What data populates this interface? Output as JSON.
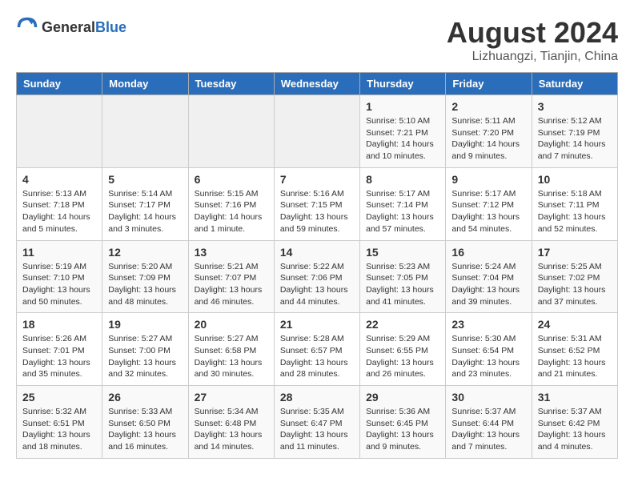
{
  "header": {
    "logo_general": "General",
    "logo_blue": "Blue",
    "month_year": "August 2024",
    "location": "Lizhuangzi, Tianjin, China"
  },
  "weekdays": [
    "Sunday",
    "Monday",
    "Tuesday",
    "Wednesday",
    "Thursday",
    "Friday",
    "Saturday"
  ],
  "weeks": [
    [
      {
        "day": "",
        "info": ""
      },
      {
        "day": "",
        "info": ""
      },
      {
        "day": "",
        "info": ""
      },
      {
        "day": "",
        "info": ""
      },
      {
        "day": "1",
        "info": "Sunrise: 5:10 AM\nSunset: 7:21 PM\nDaylight: 14 hours and 10 minutes."
      },
      {
        "day": "2",
        "info": "Sunrise: 5:11 AM\nSunset: 7:20 PM\nDaylight: 14 hours and 9 minutes."
      },
      {
        "day": "3",
        "info": "Sunrise: 5:12 AM\nSunset: 7:19 PM\nDaylight: 14 hours and 7 minutes."
      }
    ],
    [
      {
        "day": "4",
        "info": "Sunrise: 5:13 AM\nSunset: 7:18 PM\nDaylight: 14 hours and 5 minutes."
      },
      {
        "day": "5",
        "info": "Sunrise: 5:14 AM\nSunset: 7:17 PM\nDaylight: 14 hours and 3 minutes."
      },
      {
        "day": "6",
        "info": "Sunrise: 5:15 AM\nSunset: 7:16 PM\nDaylight: 14 hours and 1 minute."
      },
      {
        "day": "7",
        "info": "Sunrise: 5:16 AM\nSunset: 7:15 PM\nDaylight: 13 hours and 59 minutes."
      },
      {
        "day": "8",
        "info": "Sunrise: 5:17 AM\nSunset: 7:14 PM\nDaylight: 13 hours and 57 minutes."
      },
      {
        "day": "9",
        "info": "Sunrise: 5:17 AM\nSunset: 7:12 PM\nDaylight: 13 hours and 54 minutes."
      },
      {
        "day": "10",
        "info": "Sunrise: 5:18 AM\nSunset: 7:11 PM\nDaylight: 13 hours and 52 minutes."
      }
    ],
    [
      {
        "day": "11",
        "info": "Sunrise: 5:19 AM\nSunset: 7:10 PM\nDaylight: 13 hours and 50 minutes."
      },
      {
        "day": "12",
        "info": "Sunrise: 5:20 AM\nSunset: 7:09 PM\nDaylight: 13 hours and 48 minutes."
      },
      {
        "day": "13",
        "info": "Sunrise: 5:21 AM\nSunset: 7:07 PM\nDaylight: 13 hours and 46 minutes."
      },
      {
        "day": "14",
        "info": "Sunrise: 5:22 AM\nSunset: 7:06 PM\nDaylight: 13 hours and 44 minutes."
      },
      {
        "day": "15",
        "info": "Sunrise: 5:23 AM\nSunset: 7:05 PM\nDaylight: 13 hours and 41 minutes."
      },
      {
        "day": "16",
        "info": "Sunrise: 5:24 AM\nSunset: 7:04 PM\nDaylight: 13 hours and 39 minutes."
      },
      {
        "day": "17",
        "info": "Sunrise: 5:25 AM\nSunset: 7:02 PM\nDaylight: 13 hours and 37 minutes."
      }
    ],
    [
      {
        "day": "18",
        "info": "Sunrise: 5:26 AM\nSunset: 7:01 PM\nDaylight: 13 hours and 35 minutes."
      },
      {
        "day": "19",
        "info": "Sunrise: 5:27 AM\nSunset: 7:00 PM\nDaylight: 13 hours and 32 minutes."
      },
      {
        "day": "20",
        "info": "Sunrise: 5:27 AM\nSunset: 6:58 PM\nDaylight: 13 hours and 30 minutes."
      },
      {
        "day": "21",
        "info": "Sunrise: 5:28 AM\nSunset: 6:57 PM\nDaylight: 13 hours and 28 minutes."
      },
      {
        "day": "22",
        "info": "Sunrise: 5:29 AM\nSunset: 6:55 PM\nDaylight: 13 hours and 26 minutes."
      },
      {
        "day": "23",
        "info": "Sunrise: 5:30 AM\nSunset: 6:54 PM\nDaylight: 13 hours and 23 minutes."
      },
      {
        "day": "24",
        "info": "Sunrise: 5:31 AM\nSunset: 6:52 PM\nDaylight: 13 hours and 21 minutes."
      }
    ],
    [
      {
        "day": "25",
        "info": "Sunrise: 5:32 AM\nSunset: 6:51 PM\nDaylight: 13 hours and 18 minutes."
      },
      {
        "day": "26",
        "info": "Sunrise: 5:33 AM\nSunset: 6:50 PM\nDaylight: 13 hours and 16 minutes."
      },
      {
        "day": "27",
        "info": "Sunrise: 5:34 AM\nSunset: 6:48 PM\nDaylight: 13 hours and 14 minutes."
      },
      {
        "day": "28",
        "info": "Sunrise: 5:35 AM\nSunset: 6:47 PM\nDaylight: 13 hours and 11 minutes."
      },
      {
        "day": "29",
        "info": "Sunrise: 5:36 AM\nSunset: 6:45 PM\nDaylight: 13 hours and 9 minutes."
      },
      {
        "day": "30",
        "info": "Sunrise: 5:37 AM\nSunset: 6:44 PM\nDaylight: 13 hours and 7 minutes."
      },
      {
        "day": "31",
        "info": "Sunrise: 5:37 AM\nSunset: 6:42 PM\nDaylight: 13 hours and 4 minutes."
      }
    ]
  ]
}
